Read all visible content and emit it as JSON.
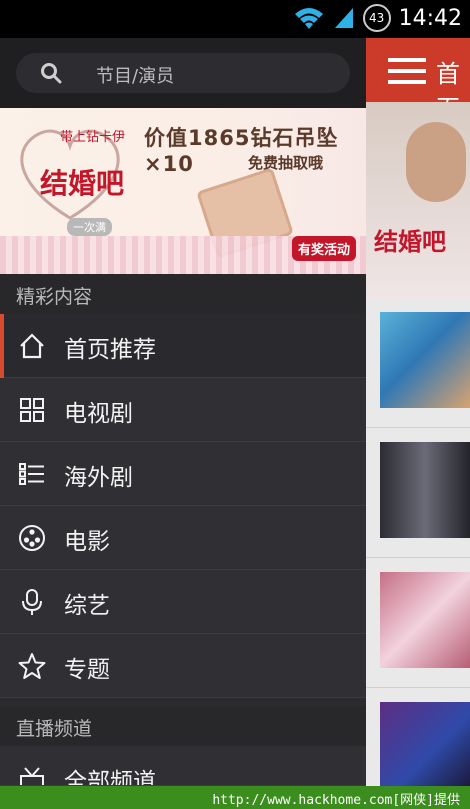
{
  "status": {
    "battery": "43",
    "time": "14:42"
  },
  "search": {
    "placeholder": "节目/演员"
  },
  "banner": {
    "headline": "价值1865钻石吊坠×10",
    "sub": "免费抽取哦",
    "brand": "结婚吧",
    "small1": "带上钻卡伊",
    "small2": "一次满",
    "prize": "有奖活动"
  },
  "sections": {
    "featured": "精彩内容",
    "live": "直播频道"
  },
  "menu": [
    {
      "label": "首页推荐",
      "icon": "home-icon"
    },
    {
      "label": "电视剧",
      "icon": "grid-icon"
    },
    {
      "label": "海外剧",
      "icon": "list-icon"
    },
    {
      "label": "电影",
      "icon": "film-reel-icon"
    },
    {
      "label": "综艺",
      "icon": "microphone-icon"
    },
    {
      "label": "专题",
      "icon": "star-icon"
    },
    {
      "label": "全部频道",
      "icon": "all-channels-icon"
    }
  ],
  "content": {
    "header_title": "首页",
    "hero_brand": "结婚吧"
  },
  "footer": {
    "text": "http://www.hackhome.com[网侠]提供"
  },
  "colors": {
    "accent": "#cc3b29",
    "active_bar": "#d84b2f",
    "footer": "#3b8d1e"
  }
}
